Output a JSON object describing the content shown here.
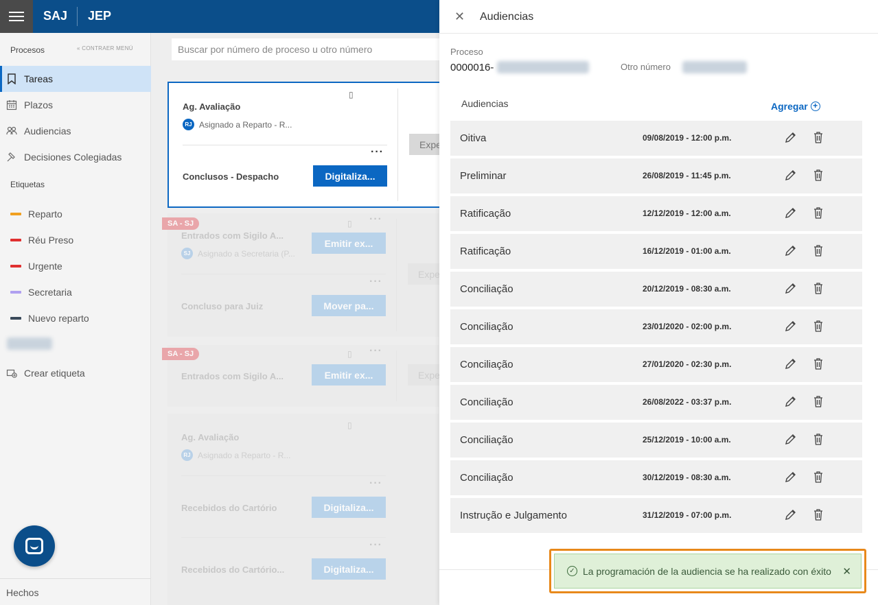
{
  "header": {
    "brand1": "SAJ",
    "brand2": "JEP"
  },
  "sidebar": {
    "section_title": "Procesos",
    "collapse_label": "CONTRAER MENÚ",
    "items": [
      {
        "label": "Tareas",
        "icon": "bookmark-icon",
        "active": true
      },
      {
        "label": "Plazos",
        "icon": "calendar-icon"
      },
      {
        "label": "Audiencias",
        "icon": "people-icon"
      },
      {
        "label": "Decisiones Colegiadas",
        "icon": "gavel-icon"
      }
    ],
    "tags_title": "Etiquetas",
    "tags": [
      {
        "label": "Reparto",
        "color": "#f0a020"
      },
      {
        "label": "Réu Preso",
        "color": "#e03030"
      },
      {
        "label": "Urgente",
        "color": "#e03030"
      },
      {
        "label": "Secretaria",
        "color": "#b0a0f0"
      },
      {
        "label": "Nuevo reparto",
        "color": "#3a4a5a"
      }
    ],
    "create_tag": "Crear etiqueta",
    "footer": "Hechos"
  },
  "main": {
    "search_placeholder": "Buscar por número de proceso u otro número",
    "cards": [
      {
        "title1": "Ag. Avaliação",
        "assign1": "Asignado a Reparto - R...",
        "avatar1": "RJ",
        "title2": "Conclusos - Despacho",
        "button2": "Digitaliza...",
        "side_button": "Expe"
      },
      {
        "flag": "SA - SJ",
        "title1": "Entrados com Sigilo A...",
        "button1": "Emitir ex...",
        "assign1": "Asignado a Secretaria (P...",
        "avatar1": "SJ",
        "title2": "Concluso para Juiz",
        "button2": "Mover pa...",
        "side_button": "Expe"
      },
      {
        "flag": "SA - SJ",
        "title1": "Entrados com Sigilo A...",
        "button1": "Emitir ex...",
        "side_button": "Expe"
      },
      {
        "title1": "Ag. Avaliação",
        "assign1": "Asignado a Reparto - R...",
        "avatar1": "RJ",
        "title2": "Recebidos do Cartório",
        "button2": "Digitaliza...",
        "title3": "Recebidos do Cartório...",
        "button3": "Digitaliza..."
      }
    ]
  },
  "panel": {
    "title": "Audiencias",
    "proceso_label": "Proceso",
    "proceso_value": "0000016-",
    "otro_label": "Otro número",
    "section": "Audiencias",
    "add_label": "Agregar",
    "rows": [
      {
        "name": "Oitiva",
        "datetime": "09/08/2019 - 12:00 p.m."
      },
      {
        "name": "Preliminar",
        "datetime": "26/08/2019 - 11:45 p.m."
      },
      {
        "name": "Ratificação",
        "datetime": "12/12/2019 - 12:00 a.m."
      },
      {
        "name": "Ratificação",
        "datetime": "16/12/2019 - 01:00 a.m."
      },
      {
        "name": "Conciliação",
        "datetime": "20/12/2019 - 08:30 a.m."
      },
      {
        "name": "Conciliação",
        "datetime": "23/01/2020 - 02:00 p.m."
      },
      {
        "name": "Conciliação",
        "datetime": "27/01/2020 - 02:30 p.m."
      },
      {
        "name": "Conciliação",
        "datetime": "26/08/2022 - 03:37 p.m."
      },
      {
        "name": "Conciliação",
        "datetime": "25/12/2019 - 10:00 a.m."
      },
      {
        "name": "Conciliação",
        "datetime": "30/12/2019 - 08:30 a.m."
      },
      {
        "name": "Instrução e Julgamento",
        "datetime": "31/12/2019 - 07:00 p.m."
      }
    ]
  },
  "toast": {
    "message": "La programación de la audiencia se ha realizado con éxito"
  }
}
